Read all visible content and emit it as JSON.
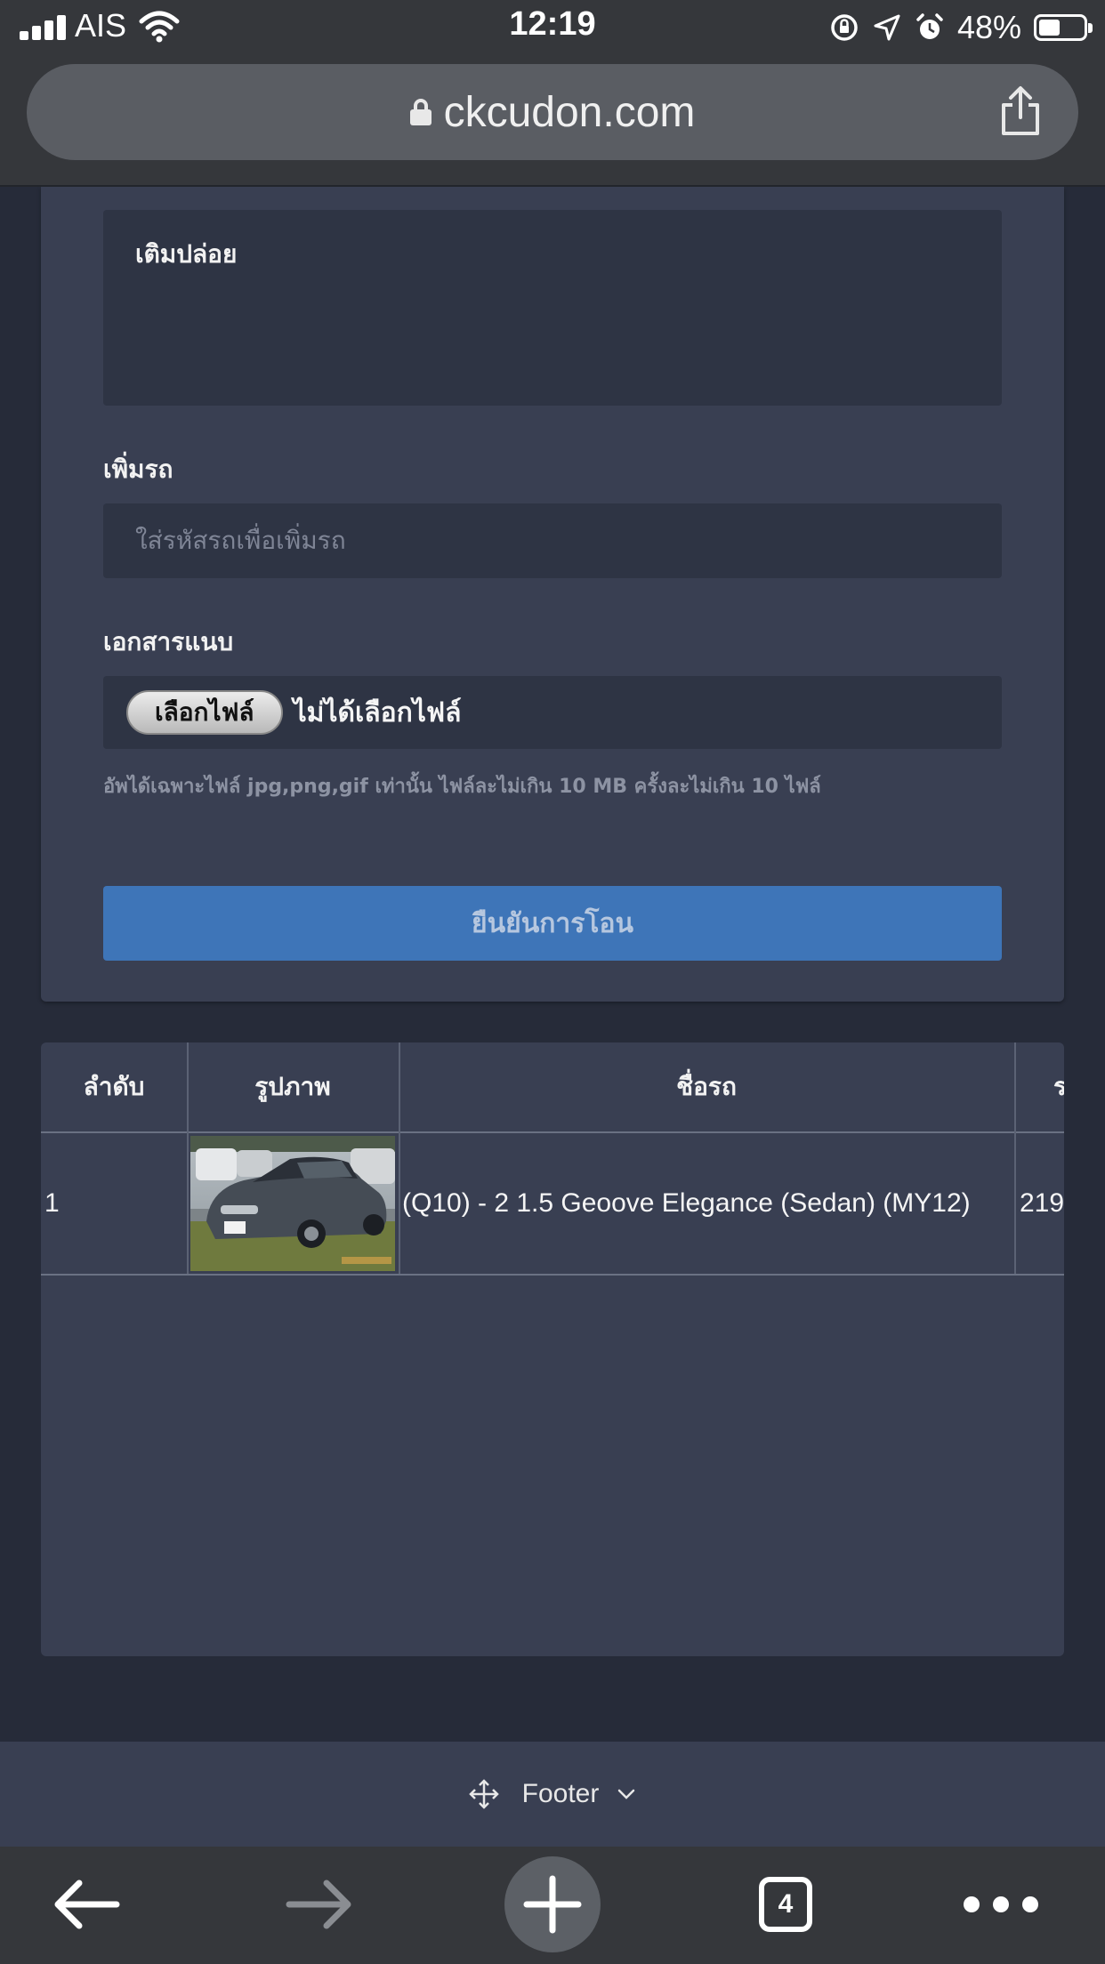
{
  "status_bar": {
    "carrier": "AIS",
    "time": "12:19",
    "battery_percent": "48%",
    "battery_level": 0.48,
    "icons": [
      "signal-icon",
      "wifi-icon",
      "rotation-lock-icon",
      "location-icon",
      "alarm-icon",
      "battery-icon"
    ]
  },
  "browser": {
    "url": "ckcudon.com",
    "tab_count": "4",
    "icons": [
      "lock-icon",
      "share-icon",
      "back-icon",
      "forward-icon",
      "new-tab-icon",
      "more-icon"
    ]
  },
  "form": {
    "note_text": "เติมปล่อย",
    "add_car_label": "เพิ่มรถ",
    "add_car_placeholder": "ใส่รหัสรถเพื่อเพิ่มรถ",
    "attach_label": "เอกสารแนบ",
    "choose_file_button": "เลือกไฟล์",
    "no_file_text": "ไม่ได้เลือกไฟล์",
    "upload_hint": "อัพได้เฉพาะไฟล์ jpg,png,gif เท่านั้น ไฟล์ละไม่เกิน 10 MB ครั้งละไม่เกิน 10 ไฟล์",
    "submit_button": "ยืนยันการโอน"
  },
  "table": {
    "headers": [
      "ลำดับ",
      "รูปภาพ",
      "ชื่อรถ",
      "ร"
    ],
    "rows": [
      {
        "index": "1",
        "name": "(Q10) - 2 1.5 Geoove Elegance (Sedan) (MY12)",
        "partial": "219"
      }
    ]
  },
  "footer": {
    "label": "Footer"
  },
  "colors": {
    "page_bg": "#262b39",
    "card_bg": "#393f52",
    "input_bg": "#2e3444",
    "accent": "#3e75b8",
    "browser_chrome": "#35373b"
  }
}
